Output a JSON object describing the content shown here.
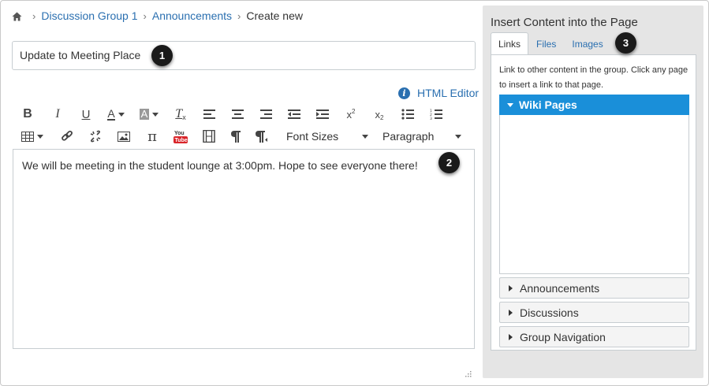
{
  "breadcrumb": {
    "icon": "home-icon",
    "items": [
      "Discussion Group 1",
      "Announcements",
      "Create new"
    ]
  },
  "title_field": {
    "value": "Update to Meeting Place"
  },
  "callouts": [
    "1",
    "2",
    "3"
  ],
  "html_editor": {
    "icon": "info-icon",
    "label": "HTML Editor"
  },
  "toolbar": {
    "row1_icons": [
      "bold-icon",
      "italic-icon",
      "underline-icon",
      "text-color-icon",
      "background-color-icon",
      "clear-formatting-icon",
      "align-left-icon",
      "align-center-icon",
      "align-right-icon",
      "outdent-icon",
      "indent-icon",
      "superscript-icon",
      "subscript-icon",
      "bullet-list-icon",
      "numbered-list-icon"
    ],
    "row2_icons": [
      "table-icon",
      "link-icon",
      "unlink-icon",
      "image-icon",
      "math-icon",
      "youtube-icon",
      "media-icon",
      "ltr-icon",
      "rtl-icon"
    ],
    "font_sizes": "Font Sizes",
    "paragraph": "Paragraph"
  },
  "editor": {
    "body": "We will be meeting in the student lounge at 3:00pm. Hope to see everyone there!"
  },
  "sidebar": {
    "title": "Insert Content into the Page",
    "tabs": [
      {
        "label": "Links",
        "active": true
      },
      {
        "label": "Files",
        "active": false
      },
      {
        "label": "Images",
        "active": false
      }
    ],
    "description": "Link to other content in the group. Click any page to insert a link to that page.",
    "wiki_header": "Wiki Pages",
    "sections": [
      "Announcements",
      "Discussions",
      "Group Navigation"
    ]
  },
  "colors": {
    "link": "#2a6fb0",
    "accent": "#1a8fd9",
    "panel": "#e5e5e5",
    "badge": "#1a1a1a"
  }
}
